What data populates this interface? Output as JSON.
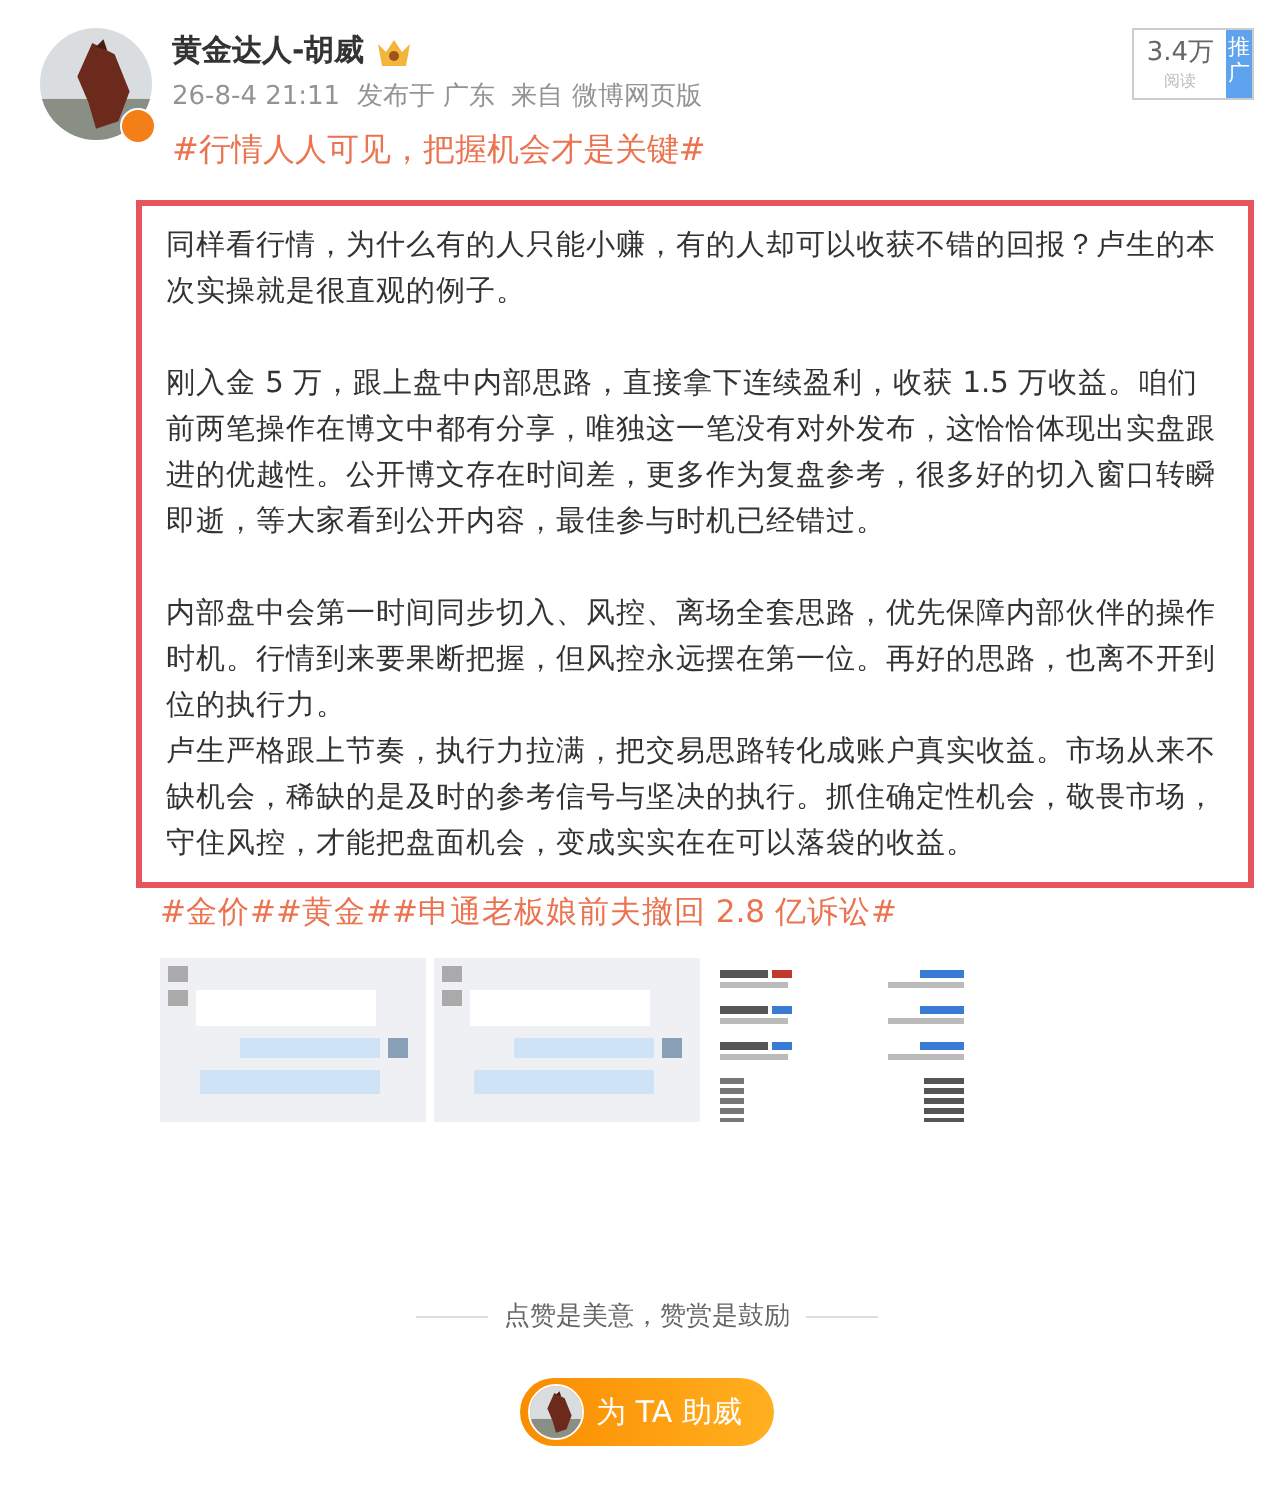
{
  "author": {
    "name": "黄金达人-胡威",
    "verified": true,
    "meta": "26-8-4 21:11  发布于 广东  来自 微博网页版"
  },
  "reads": {
    "count": "3.4万",
    "label": "阅读",
    "promote": "推广"
  },
  "topic": "#行情人人可见，把握机会才是关键#",
  "sections": [
    [
      "同样看行情，为什么有的人只能小赚，有的人却可以收获不错的回报？卢生的本次实操就是很直观的例子。"
    ],
    [
      "刚入金 5 万，跟上盘中内部思路，直接拿下连续盈利，收获 1.5 万收益。咱们前两笔操作在博文中都有分享，唯独这一笔没有对外发布，这恰恰体现出实盘跟进的优越性。公开博文存在时间差，更多作为复盘参考，很多好的切入窗口转瞬即逝，等大家看到公开内容，最佳参与时机已经错过。"
    ],
    [
      "内部盘中会第一时间同步切入、风控、离场全套思路，优先保障内部伙伴的操作时机。行情到来要果断把握，但风控永远摆在第一位。再好的思路，也离不开到位的执行力。",
      "卢生严格跟上节奏，执行力拉满，把交易思路转化成账户真实收益。市场从来不缺机会，稀缺的是及时的参考信号与坚决的执行。抓住确定性机会，敬畏市场，守住风控，才能把盘面机会，变成实实在在可以落袋的收益。"
    ]
  ],
  "tags": [
    "#金价#",
    "#黄金#",
    "#申通老板娘前夫撤回 2.8 亿诉讼#"
  ],
  "images": [
    {
      "kind": "chat"
    },
    {
      "kind": "chat"
    },
    {
      "kind": "trades"
    }
  ],
  "divider_text": "点赞是美意，赞赏是鼓励",
  "reward_button": "为 TA 助威"
}
